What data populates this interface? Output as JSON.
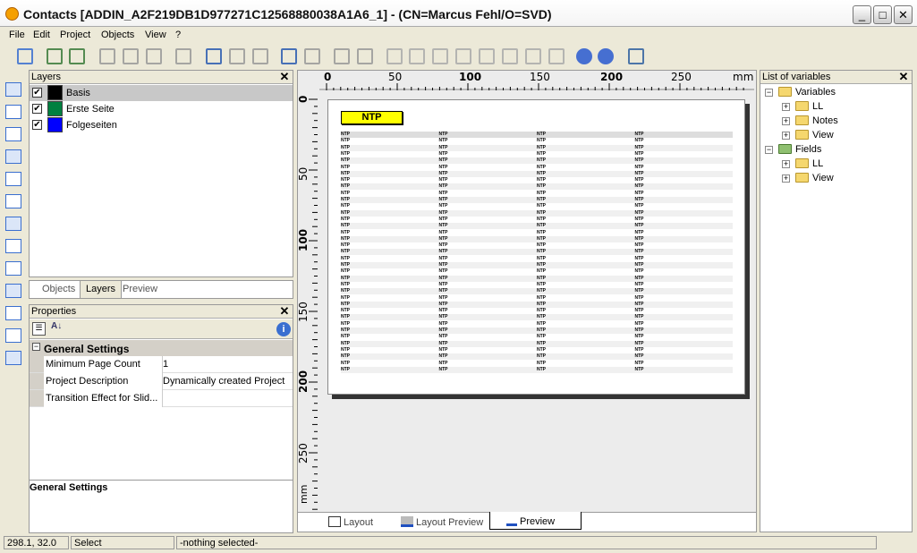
{
  "window": {
    "title": "Contacts [ADDIN_A2F219DB1D977271C12568880038A1A6_1] - (CN=Marcus Fehl/O=SVD)",
    "minimize": "_",
    "maximize": "□",
    "close": "✕"
  },
  "menu": [
    "File",
    "Edit",
    "Project",
    "Objects",
    "View",
    "?"
  ],
  "toolbar": [
    "save-icon",
    "print-icon",
    "print-preview-icon",
    "cut-icon",
    "copy-icon",
    "paste-icon",
    "undo-icon",
    "zoom-in-icon",
    "zoom-out-icon",
    "zoom-fit-icon",
    "refresh-icon",
    "properties-icon",
    "layer-up-icon",
    "layer-down-icon",
    "align-left-icon",
    "align-right-icon",
    "align-top-icon",
    "align-bottom-icon",
    "distribute-h-icon",
    "distribute-v-icon",
    "same-width-icon",
    "same-height-icon",
    "help-icon",
    "context-help-icon",
    "exit-icon"
  ],
  "layers": {
    "title": "Layers",
    "items": [
      {
        "name": "Basis",
        "color": "#000000",
        "checked": true,
        "selected": true
      },
      {
        "name": "Erste Seite",
        "color": "#008040",
        "checked": true
      },
      {
        "name": "Folgeseiten",
        "color": "#0000ff",
        "checked": true
      }
    ]
  },
  "left_tabs": [
    "Objects",
    "Layers",
    "Preview"
  ],
  "properties": {
    "title": "Properties",
    "section": "General Settings",
    "rows": [
      {
        "key": "Minimum Page Count",
        "value": "1"
      },
      {
        "key": "Project Description",
        "value": "Dynamically created Project"
      },
      {
        "key": "Transition Effect for Slid...",
        "value": ""
      }
    ],
    "description_title": "General Settings"
  },
  "ruler": {
    "h_labels": [
      "0",
      "50",
      "100",
      "150",
      "200",
      "250"
    ],
    "v_labels": [
      "0",
      "50",
      "100",
      "150",
      "200",
      "250"
    ],
    "unit": "mm"
  },
  "report": {
    "header": "NTP",
    "cell": "NTP",
    "columns": 4,
    "row_count": 37,
    "accent": "#ffff00"
  },
  "bottom_tabs": [
    {
      "label": "Layout"
    },
    {
      "label": "Layout Preview"
    },
    {
      "label": "Preview",
      "active": true
    }
  ],
  "variables": {
    "title": "List of variables",
    "tree": [
      {
        "label": "Variables",
        "children": [
          "LL",
          "Notes",
          "View"
        ]
      },
      {
        "label": "Fields",
        "children": [
          "LL",
          "View"
        ]
      }
    ]
  },
  "status": {
    "coords": "298.1, 32.0",
    "mode": "Select",
    "selection": "-nothing selected-"
  }
}
